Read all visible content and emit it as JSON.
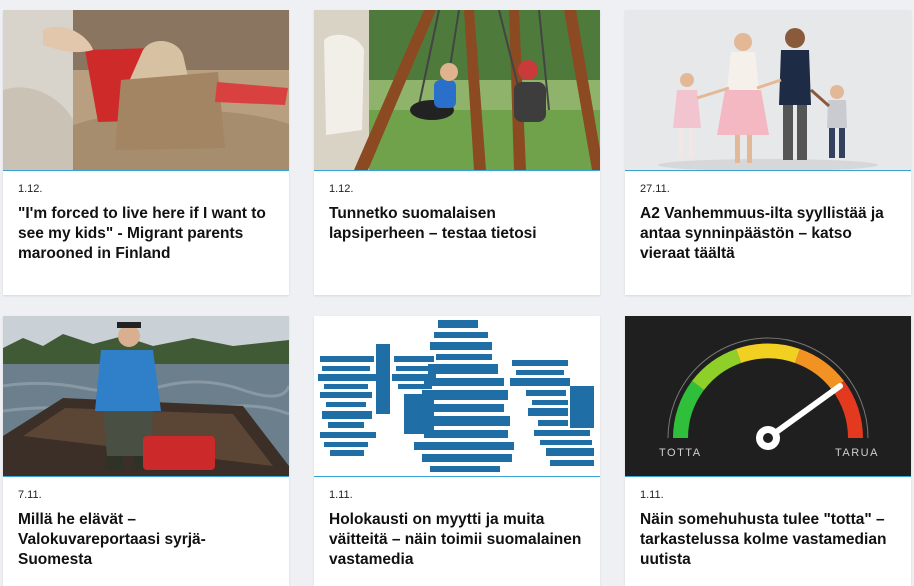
{
  "articles": [
    {
      "date": "1.12.",
      "title": "\"I'm forced to live here if I want to see my kids\" - Migrant parents marooned in Finland",
      "image": "sandcastle-photo"
    },
    {
      "date": "1.12.",
      "title": "Tunnetko suomalaisen lapsiperheen – testaa tietosi",
      "image": "swing-photo"
    },
    {
      "date": "27.11.",
      "title": "A2 Vanhemmuus-ilta syyllistää ja antaa synninpäästön – katso vieraat täältä",
      "image": "family-photo"
    },
    {
      "date": "7.11.",
      "title": "Millä he elävät – Valokuvareportaasi syrjä-Suomesta",
      "image": "boat-photo"
    },
    {
      "date": "1.11.",
      "title": "Holokausti on myytti ja muita väitteitä – näin toimii suomalainen vastamedia",
      "image": "wordcloud-image"
    },
    {
      "date": "1.11.",
      "title": "Näin somehuhusta tulee \"totta\" – tarkastelussa kolme vastamedian uutista",
      "image": "truth-meter-image"
    }
  ],
  "meter": {
    "left_label": "TOTTA",
    "right_label": "TARUA"
  }
}
